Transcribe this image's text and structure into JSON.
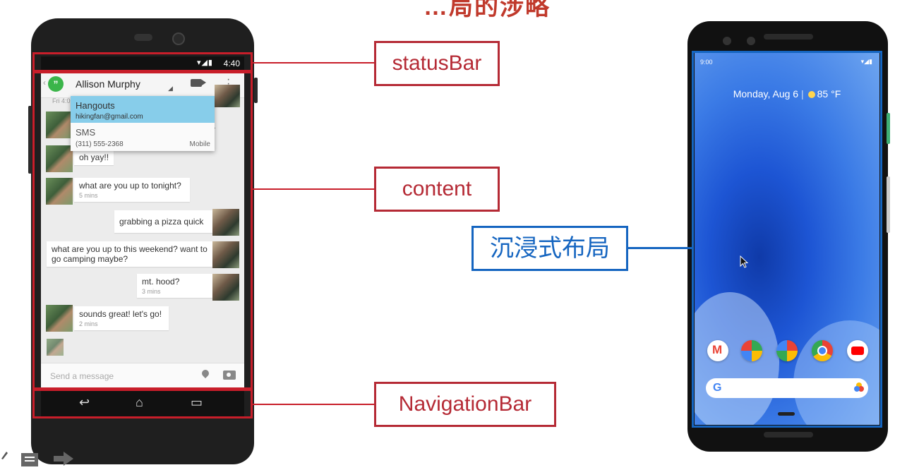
{
  "title_fragment": "…局的涉略",
  "annotations": {
    "status_bar": "statusBar",
    "content": "content",
    "navigation_bar": "NavigationBar",
    "immersive": "沉浸式布局"
  },
  "left_phone": {
    "status_time": "4:40",
    "status_icons": "▾◢▮",
    "contact_name": "Allison Murphy",
    "date_fragment": "Fri 4:0",
    "dropdown": [
      {
        "title": "Hangouts",
        "sub": "hikingfan@gmail.com",
        "tag": ""
      },
      {
        "title": "SMS",
        "sub": "(311) 555-2368",
        "tag": "Mobile"
      }
    ],
    "messages": [
      {
        "text": "oh yay!!",
        "time": ""
      },
      {
        "text": "what are you up to tonight?",
        "time": "5 mins"
      },
      {
        "text": "grabbing a pizza quick",
        "time": ""
      },
      {
        "text": "what are you up to this weekend? want to go camping maybe?",
        "time": ""
      },
      {
        "text": "mt. hood?",
        "time": "3 mins"
      },
      {
        "text": "sounds great! let's go!",
        "time": "2 mins"
      }
    ],
    "composer_placeholder": "Send a message",
    "nav": {
      "back": "↩",
      "home": "⌂",
      "recents": "▭"
    }
  },
  "right_phone": {
    "status_time": "9:00",
    "status_icons": "▾◢▮",
    "date": "Monday, Aug 6",
    "temperature": "85 °F",
    "dock_apps": [
      "gmail-icon",
      "maps-icon",
      "photos-icon",
      "chrome-icon",
      "youtube-icon"
    ],
    "search_g": "G"
  },
  "colors": {
    "annotation_red": "#c81e2a",
    "annotation_blue": "#1565c0"
  }
}
